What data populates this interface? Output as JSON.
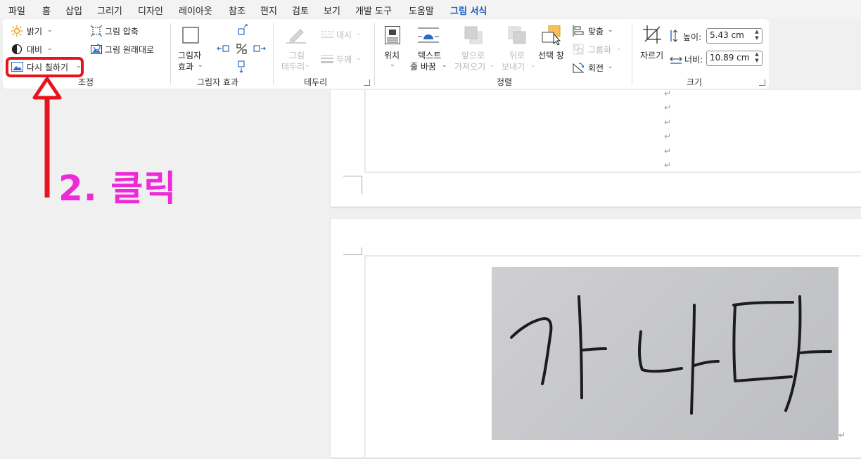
{
  "menu": {
    "tabs": [
      "파일",
      "홈",
      "삽입",
      "그리기",
      "디자인",
      "레이아웃",
      "참조",
      "편지",
      "검토",
      "보기",
      "개발 도구",
      "도움말",
      "그림 서식"
    ],
    "active_index": 12
  },
  "ribbon": {
    "adjust": {
      "brightness": "밝기",
      "contrast": "대비",
      "recolor": "다시 칠하기",
      "compress": "그림 압축",
      "reset": "그림 원래대로",
      "label": "조정"
    },
    "picture_effects": {
      "button": [
        "그림자",
        "효과"
      ],
      "label": "그림자 효과"
    },
    "border": {
      "button": [
        "그림",
        "테두리"
      ],
      "dash": "대시",
      "weight": "두께",
      "label": "테두리"
    },
    "arrange": {
      "position": "위치",
      "wrap": [
        "텍스트",
        "줄 바꿈"
      ],
      "bring_forward": [
        "앞으로",
        "가져오기"
      ],
      "send_backward": [
        "뒤로",
        "보내기"
      ],
      "selection_pane": "선택 창",
      "align": "맞춤",
      "group": "그룹화",
      "rotate": "회전",
      "label": "정렬"
    },
    "size": {
      "crop": "자르기",
      "height_label": "높이:",
      "height_value": "5.43 cm",
      "width_label": "너비:",
      "width_value": "10.89 cm",
      "label": "크기"
    }
  },
  "document": {
    "paragraph_mark": "↵",
    "image_text": "가나다"
  },
  "annotation": {
    "text": "2. 클릭",
    "highlight_color": "#e8131c",
    "text_color": "#ee2ad8"
  }
}
